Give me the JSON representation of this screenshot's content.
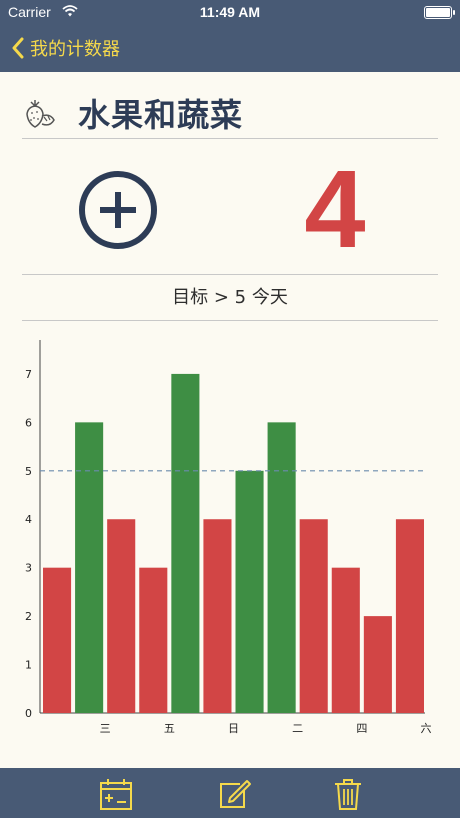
{
  "status_bar": {
    "carrier": "Carrier",
    "time": "11:49 AM"
  },
  "nav": {
    "back_label": "我的计数器"
  },
  "counter": {
    "title": "水果和蔬菜",
    "count": "4",
    "goal_text": "目标 > 5 今天",
    "icon": "strawberry-icon"
  },
  "colors": {
    "accent": "#f5d94b",
    "header_bg": "#485a75",
    "met": "#3e8e44",
    "not_met": "#d24545",
    "title_text": "#2d3c56",
    "goal_line": "#6b8bad"
  },
  "chart_data": {
    "type": "bar",
    "categories": [
      "",
      "三",
      "",
      "五",
      "",
      "日",
      "",
      "二",
      "",
      "四",
      "",
      "六"
    ],
    "values": [
      3,
      6,
      4,
      3,
      7,
      4,
      5,
      6,
      4,
      3,
      2,
      4
    ],
    "target": 5,
    "ylim": [
      0,
      7.7
    ],
    "yticks": [
      0,
      1,
      2,
      3,
      4,
      5,
      6,
      7
    ],
    "title": "",
    "xlabel": "",
    "ylabel": ""
  },
  "tab_bar": {
    "items": [
      "calendar-add-icon",
      "edit-icon",
      "trash-icon"
    ]
  }
}
